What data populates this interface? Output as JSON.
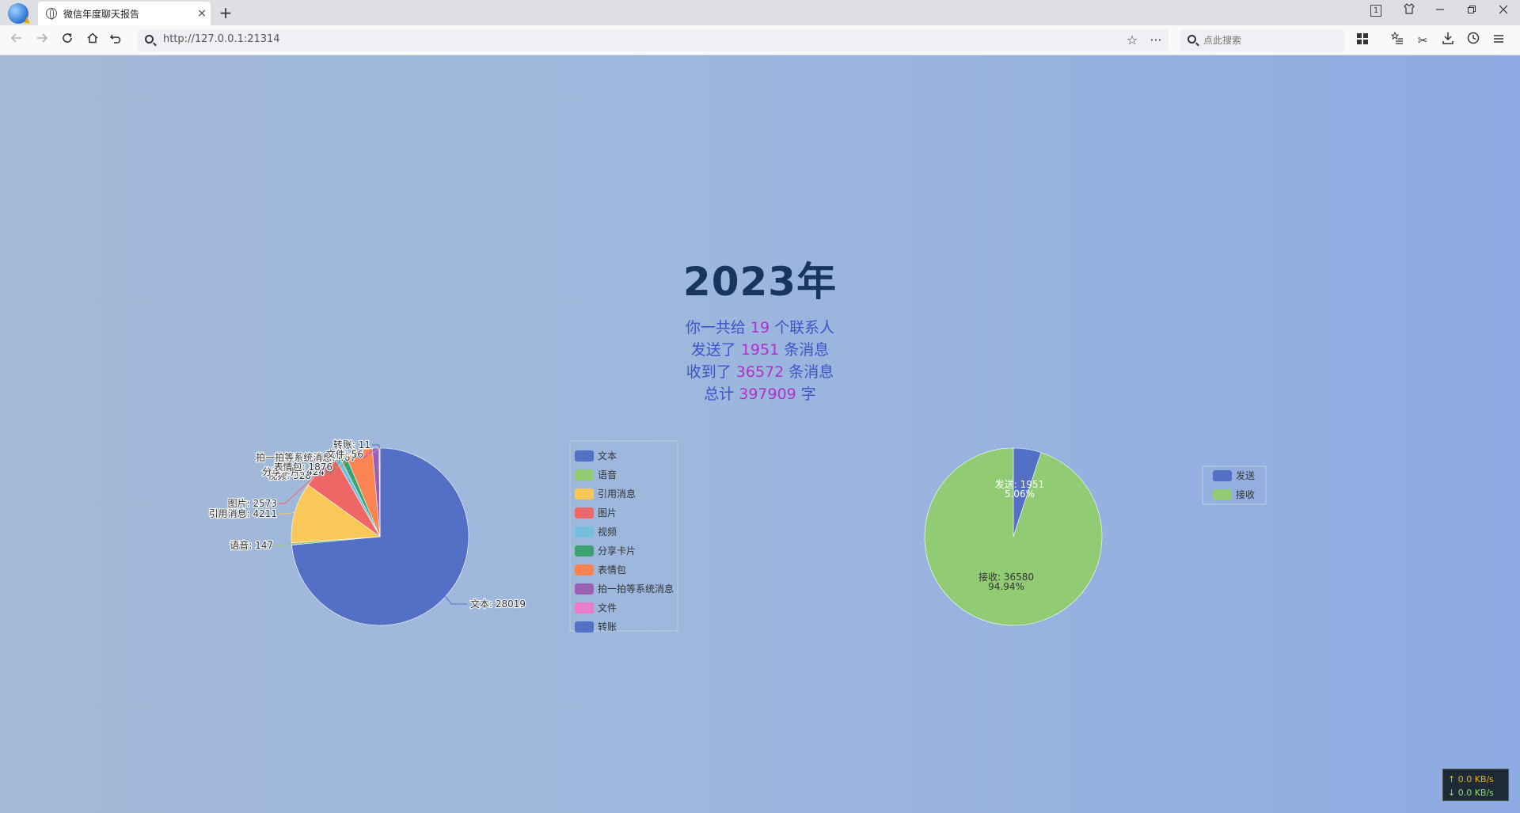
{
  "browser": {
    "tab_title": "微信年度聊天报告",
    "tab_close": "×",
    "new_tab": "+",
    "tab_count": "1",
    "url": "http://127.0.0.1:21314",
    "search_placeholder": "点此搜索"
  },
  "report": {
    "year": "2023年",
    "lines": [
      {
        "prefix": "你一共给 ",
        "num": "19",
        "suffix": " 个联系人"
      },
      {
        "prefix": "发送了 ",
        "num": "1951",
        "suffix": " 条消息"
      },
      {
        "prefix": "收到了 ",
        "num": "36572",
        "suffix": " 条消息"
      },
      {
        "prefix": "总计 ",
        "num": "397909",
        "suffix": " 字"
      }
    ]
  },
  "netspeed": {
    "up": "↑ 0.0 KB/s",
    "down": "↓ 0.0 KB/s"
  },
  "chart_data": [
    {
      "type": "pie",
      "title": "",
      "legend_position": "right",
      "categories": [
        "文本",
        "语音",
        "引用消息",
        "图片",
        "视频",
        "分享卡片",
        "表情包",
        "拍一拍等系统消息",
        "文件",
        "转账"
      ],
      "values": [
        28019,
        147,
        4211,
        2573,
        328,
        424,
        1876,
        467,
        56,
        11
      ],
      "colors": [
        "#5470c6",
        "#91cc75",
        "#fac858",
        "#ee6666",
        "#73c0de",
        "#3ba272",
        "#fc8452",
        "#9a60b4",
        "#ea7ccc",
        "#5470c6"
      ],
      "labels": [
        "文本: 28019",
        "语音: 147",
        "引用消息: 4211",
        "图片: 2573",
        "视频: 328",
        "分享卡片: 424",
        "表情包: 1876",
        "拍一拍等系统消息: 467",
        "文件: 56",
        "转账: 11"
      ]
    },
    {
      "type": "pie",
      "title": "",
      "legend_position": "right",
      "categories": [
        "发送",
        "接收"
      ],
      "values": [
        1951,
        36580
      ],
      "colors": [
        "#5470c6",
        "#91cc75"
      ],
      "labels": [
        "发送: 1951",
        "接收: 36580"
      ],
      "percent_labels": [
        "5.06%",
        "94.94%"
      ]
    }
  ]
}
